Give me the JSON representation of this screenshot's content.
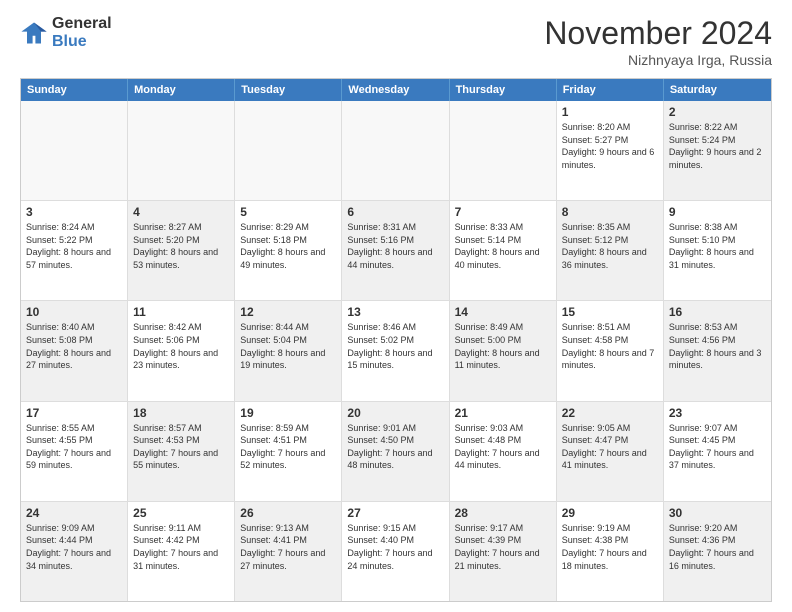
{
  "header": {
    "logo_line1": "General",
    "logo_line2": "Blue",
    "month_title": "November 2024",
    "location": "Nizhnyaya Irga, Russia"
  },
  "days_of_week": [
    "Sunday",
    "Monday",
    "Tuesday",
    "Wednesday",
    "Thursday",
    "Friday",
    "Saturday"
  ],
  "rows": [
    [
      {
        "day": "",
        "info": "",
        "empty": true
      },
      {
        "day": "",
        "info": "",
        "empty": true
      },
      {
        "day": "",
        "info": "",
        "empty": true
      },
      {
        "day": "",
        "info": "",
        "empty": true
      },
      {
        "day": "",
        "info": "",
        "empty": true
      },
      {
        "day": "1",
        "info": "Sunrise: 8:20 AM\nSunset: 5:27 PM\nDaylight: 9 hours and 6 minutes.",
        "empty": false
      },
      {
        "day": "2",
        "info": "Sunrise: 8:22 AM\nSunset: 5:24 PM\nDaylight: 9 hours and 2 minutes.",
        "empty": false,
        "shaded": true
      }
    ],
    [
      {
        "day": "3",
        "info": "Sunrise: 8:24 AM\nSunset: 5:22 PM\nDaylight: 8 hours and 57 minutes.",
        "empty": false
      },
      {
        "day": "4",
        "info": "Sunrise: 8:27 AM\nSunset: 5:20 PM\nDaylight: 8 hours and 53 minutes.",
        "empty": false,
        "shaded": true
      },
      {
        "day": "5",
        "info": "Sunrise: 8:29 AM\nSunset: 5:18 PM\nDaylight: 8 hours and 49 minutes.",
        "empty": false
      },
      {
        "day": "6",
        "info": "Sunrise: 8:31 AM\nSunset: 5:16 PM\nDaylight: 8 hours and 44 minutes.",
        "empty": false,
        "shaded": true
      },
      {
        "day": "7",
        "info": "Sunrise: 8:33 AM\nSunset: 5:14 PM\nDaylight: 8 hours and 40 minutes.",
        "empty": false
      },
      {
        "day": "8",
        "info": "Sunrise: 8:35 AM\nSunset: 5:12 PM\nDaylight: 8 hours and 36 minutes.",
        "empty": false,
        "shaded": true
      },
      {
        "day": "9",
        "info": "Sunrise: 8:38 AM\nSunset: 5:10 PM\nDaylight: 8 hours and 31 minutes.",
        "empty": false
      }
    ],
    [
      {
        "day": "10",
        "info": "Sunrise: 8:40 AM\nSunset: 5:08 PM\nDaylight: 8 hours and 27 minutes.",
        "empty": false,
        "shaded": true
      },
      {
        "day": "11",
        "info": "Sunrise: 8:42 AM\nSunset: 5:06 PM\nDaylight: 8 hours and 23 minutes.",
        "empty": false
      },
      {
        "day": "12",
        "info": "Sunrise: 8:44 AM\nSunset: 5:04 PM\nDaylight: 8 hours and 19 minutes.",
        "empty": false,
        "shaded": true
      },
      {
        "day": "13",
        "info": "Sunrise: 8:46 AM\nSunset: 5:02 PM\nDaylight: 8 hours and 15 minutes.",
        "empty": false
      },
      {
        "day": "14",
        "info": "Sunrise: 8:49 AM\nSunset: 5:00 PM\nDaylight: 8 hours and 11 minutes.",
        "empty": false,
        "shaded": true
      },
      {
        "day": "15",
        "info": "Sunrise: 8:51 AM\nSunset: 4:58 PM\nDaylight: 8 hours and 7 minutes.",
        "empty": false
      },
      {
        "day": "16",
        "info": "Sunrise: 8:53 AM\nSunset: 4:56 PM\nDaylight: 8 hours and 3 minutes.",
        "empty": false,
        "shaded": true
      }
    ],
    [
      {
        "day": "17",
        "info": "Sunrise: 8:55 AM\nSunset: 4:55 PM\nDaylight: 7 hours and 59 minutes.",
        "empty": false
      },
      {
        "day": "18",
        "info": "Sunrise: 8:57 AM\nSunset: 4:53 PM\nDaylight: 7 hours and 55 minutes.",
        "empty": false,
        "shaded": true
      },
      {
        "day": "19",
        "info": "Sunrise: 8:59 AM\nSunset: 4:51 PM\nDaylight: 7 hours and 52 minutes.",
        "empty": false
      },
      {
        "day": "20",
        "info": "Sunrise: 9:01 AM\nSunset: 4:50 PM\nDaylight: 7 hours and 48 minutes.",
        "empty": false,
        "shaded": true
      },
      {
        "day": "21",
        "info": "Sunrise: 9:03 AM\nSunset: 4:48 PM\nDaylight: 7 hours and 44 minutes.",
        "empty": false
      },
      {
        "day": "22",
        "info": "Sunrise: 9:05 AM\nSunset: 4:47 PM\nDaylight: 7 hours and 41 minutes.",
        "empty": false,
        "shaded": true
      },
      {
        "day": "23",
        "info": "Sunrise: 9:07 AM\nSunset: 4:45 PM\nDaylight: 7 hours and 37 minutes.",
        "empty": false
      }
    ],
    [
      {
        "day": "24",
        "info": "Sunrise: 9:09 AM\nSunset: 4:44 PM\nDaylight: 7 hours and 34 minutes.",
        "empty": false,
        "shaded": true
      },
      {
        "day": "25",
        "info": "Sunrise: 9:11 AM\nSunset: 4:42 PM\nDaylight: 7 hours and 31 minutes.",
        "empty": false
      },
      {
        "day": "26",
        "info": "Sunrise: 9:13 AM\nSunset: 4:41 PM\nDaylight: 7 hours and 27 minutes.",
        "empty": false,
        "shaded": true
      },
      {
        "day": "27",
        "info": "Sunrise: 9:15 AM\nSunset: 4:40 PM\nDaylight: 7 hours and 24 minutes.",
        "empty": false
      },
      {
        "day": "28",
        "info": "Sunrise: 9:17 AM\nSunset: 4:39 PM\nDaylight: 7 hours and 21 minutes.",
        "empty": false,
        "shaded": true
      },
      {
        "day": "29",
        "info": "Sunrise: 9:19 AM\nSunset: 4:38 PM\nDaylight: 7 hours and 18 minutes.",
        "empty": false
      },
      {
        "day": "30",
        "info": "Sunrise: 9:20 AM\nSunset: 4:36 PM\nDaylight: 7 hours and 16 minutes.",
        "empty": false,
        "shaded": true
      }
    ]
  ]
}
